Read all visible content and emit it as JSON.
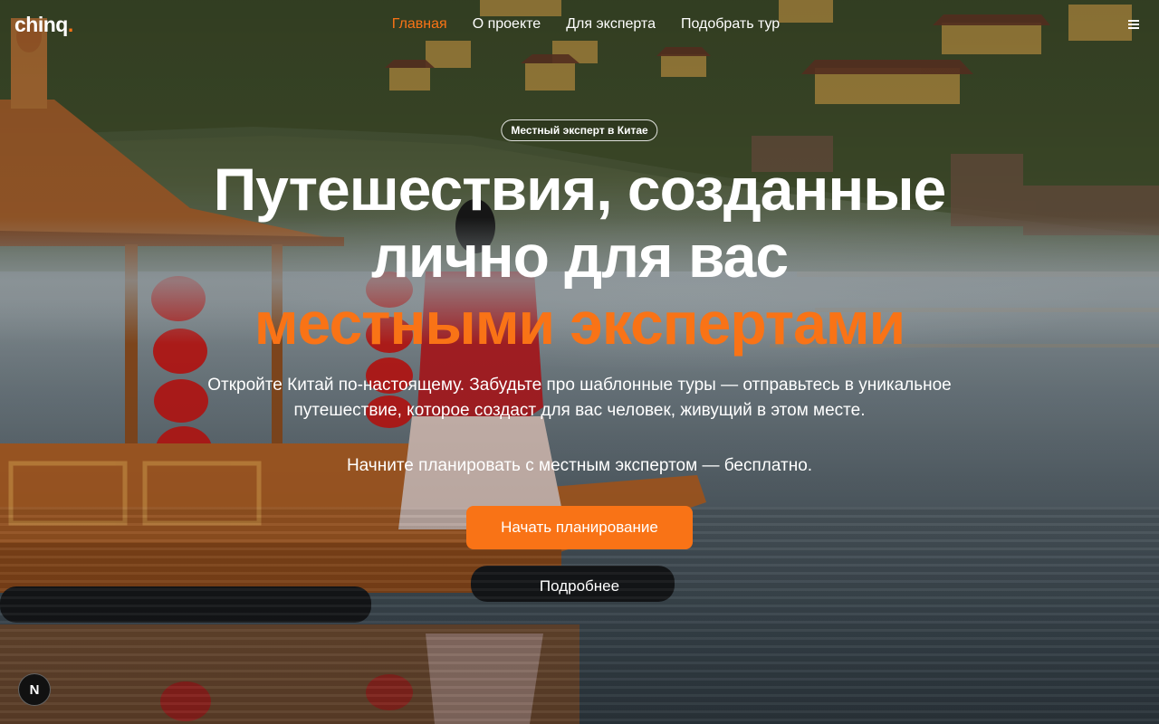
{
  "header": {
    "logo": "chinq",
    "logo_dot": ".",
    "nav": [
      {
        "label": "Главная",
        "active": true
      },
      {
        "label": "О проекте",
        "active": false
      },
      {
        "label": "Для эксперта",
        "active": false
      },
      {
        "label": "Подобрать тур",
        "active": false
      }
    ],
    "menu_icon": "hamburger-menu-icon"
  },
  "hero": {
    "badge": "Местный эксперт в Китае",
    "title_line1": "Путешествия, созданные",
    "title_line2": "лично для вас",
    "title_accent": "местными экспертами",
    "lead": "Откройте Китай по-настоящему. Забудьте про шаблонные туры — отправьтесь в уникальное путешествие, которое создаст для вас человек, живущий в этом месте.",
    "lead2": "Начните планировать с местным экспертом — бесплатно.",
    "cta_label": "Начать планирование",
    "more_label": "Подробнее"
  },
  "corner_badge": "N",
  "colors": {
    "accent": "#f97316",
    "text": "#ffffff"
  }
}
